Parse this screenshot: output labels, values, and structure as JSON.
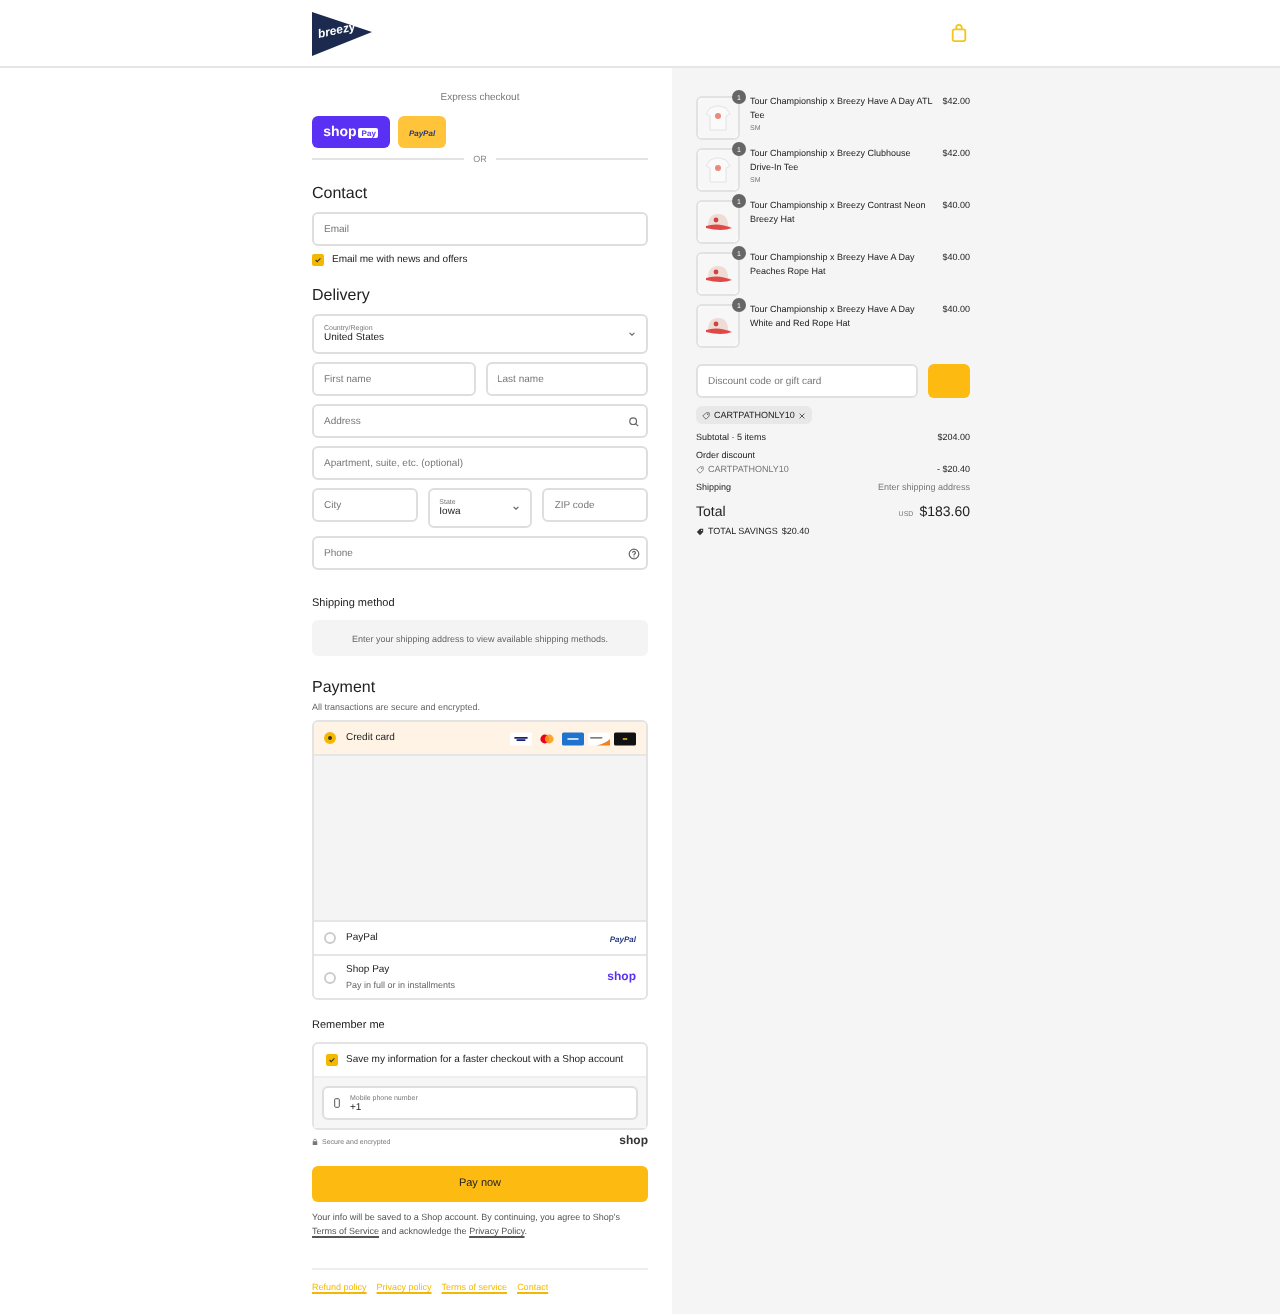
{
  "header": {
    "logo_text": "breezy"
  },
  "express": {
    "title": "Express checkout",
    "buttons": [
      {
        "kind": "shop_pay",
        "label": "shop",
        "badge": "Pay"
      },
      {
        "kind": "paypal",
        "label": "PayPal"
      }
    ],
    "separator": "OR"
  },
  "contact": {
    "heading": "Contact",
    "email": {
      "placeholder": "Email"
    },
    "newsletter": {
      "label": "Email me with news and offers",
      "checked": true
    }
  },
  "delivery": {
    "heading": "Delivery",
    "rows": [
      [
        {
          "kind": "select",
          "label": "Country/Region",
          "value": "United States"
        }
      ],
      [
        {
          "kind": "text",
          "placeholder": "First name"
        },
        {
          "kind": "text",
          "placeholder": "Last name"
        }
      ],
      [
        {
          "kind": "search",
          "placeholder": "Address"
        }
      ],
      [
        {
          "kind": "text",
          "placeholder": "Apartment, suite, etc. (optional)"
        }
      ],
      [
        {
          "kind": "text",
          "placeholder": "City"
        },
        {
          "kind": "select",
          "label": "State",
          "value": "Iowa"
        },
        {
          "kind": "text",
          "placeholder": "ZIP code"
        }
      ],
      [
        {
          "kind": "help",
          "placeholder": "Phone"
        }
      ]
    ]
  },
  "shipping": {
    "heading": "Shipping method",
    "message": "Enter your shipping address to view available shipping methods."
  },
  "payment": {
    "heading": "Payment",
    "subtitle": "All transactions are secure and encrypted.",
    "methods": [
      {
        "kind": "card",
        "label": "Credit card",
        "selected": true
      },
      {
        "kind": "paypal",
        "label": "PayPal",
        "brand": "PayPal",
        "selected": false
      },
      {
        "kind": "shop",
        "label": "Shop Pay",
        "note": "Pay in full or in installments",
        "brand": "shop",
        "selected": false
      }
    ]
  },
  "remember": {
    "heading": "Remember me",
    "save": {
      "label": "Save my information for a faster checkout with a Shop account",
      "checked": true
    },
    "phone": {
      "label": "Mobile phone number",
      "value": "+1"
    },
    "secure": "Secure and encrypted",
    "brand": "shop"
  },
  "pay_button": "Pay now",
  "legal": [
    {
      "kind": "text",
      "text": "Your info will be saved to a Shop account. By continuing, you agree to Shop's "
    },
    {
      "kind": "link",
      "text": "Terms of Service"
    },
    {
      "kind": "text",
      "text": " and acknowledge the "
    },
    {
      "kind": "link",
      "text": "Privacy Policy"
    },
    {
      "kind": "text",
      "text": "."
    }
  ],
  "footer_links": [
    "Refund policy",
    "Privacy policy",
    "Terms of service",
    "Contact"
  ],
  "summary": {
    "items": [
      {
        "kind": "tee",
        "name": "Tour Championship x Breezy Have A Day ATL Tee",
        "variant": "SM",
        "price": "$42.00",
        "quantity": "1"
      },
      {
        "kind": "tee",
        "name": "Tour Championship x Breezy Clubhouse Drive-In Tee",
        "variant": "SM",
        "price": "$42.00",
        "quantity": "1"
      },
      {
        "kind": "hat",
        "name": "Tour Championship x Breezy Contrast Neon Breezy Hat",
        "price": "$40.00",
        "quantity": "1"
      },
      {
        "kind": "hat",
        "name": "Tour Championship x Breezy Have A Day Peaches Rope Hat",
        "price": "$40.00",
        "quantity": "1"
      },
      {
        "kind": "hat",
        "name": "Tour Championship x Breezy Have A Day White and Red Rope Hat",
        "price": "$40.00",
        "quantity": "1"
      }
    ],
    "discount": {
      "placeholder": "Discount code or gift card"
    },
    "code": "CARTPATHONLY10",
    "subtotal": {
      "label": "Subtotal · 5 items",
      "value": "$204.00"
    },
    "order_discount": {
      "label": "Order discount",
      "code": "CARTPATHONLY10",
      "value": "- $20.40"
    },
    "shipping": {
      "label": "Shipping",
      "value": "Enter shipping address"
    },
    "total": {
      "label": "Total",
      "currency": "USD",
      "value": "$183.60"
    },
    "savings": {
      "label": "TOTAL SAVINGS",
      "value": "$20.40"
    }
  }
}
